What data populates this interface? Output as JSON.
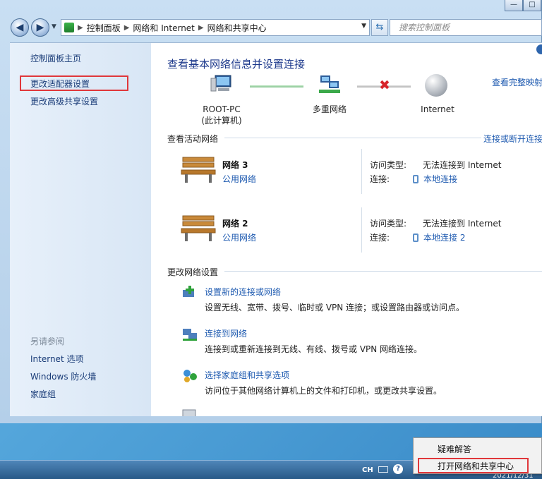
{
  "window": {
    "controls": [
      "—",
      "□"
    ]
  },
  "address": {
    "segments": [
      "控制面板",
      "网络和 Internet",
      "网络和共享中心"
    ],
    "search_placeholder": "搜索控制面板"
  },
  "sidebar": {
    "links": [
      "控制面板主页",
      "更改适配器设置",
      "更改高级共享设置"
    ],
    "see_also_title": "另请参阅",
    "see_also": [
      "Internet 选项",
      "Windows 防火墙",
      "家庭组"
    ]
  },
  "main": {
    "heading": "查看基本网络信息并设置连接",
    "full_map": "查看完整映射",
    "map": {
      "pc_name": "ROOT-PC",
      "pc_sub": "(此计算机)",
      "middle": "多重网络",
      "internet": "Internet"
    },
    "active_title": "查看活动网络",
    "connect_disconnect": "连接或断开连接",
    "networks": [
      {
        "name": "网络  3",
        "type": "公用网络",
        "access_label": "访问类型:",
        "access_value": "无法连接到 Internet",
        "conn_label": "连接:",
        "conn_value": "本地连接"
      },
      {
        "name": "网络  2",
        "type": "公用网络",
        "access_label": "访问类型:",
        "access_value": "无法连接到 Internet",
        "conn_label": "连接:",
        "conn_value": "本地连接 2"
      }
    ],
    "change_title": "更改网络设置",
    "tasks": [
      {
        "link": "设置新的连接或网络",
        "desc": "设置无线、宽带、拨号、临时或 VPN 连接；或设置路由器或访问点。"
      },
      {
        "link": "连接到网络",
        "desc": "连接到或重新连接到无线、有线、拨号或 VPN 网络连接。"
      },
      {
        "link": "选择家庭组和共享选项",
        "desc": "访问位于其他网络计算机上的文件和打印机，或更改共享设置。"
      }
    ]
  },
  "taskbar": {
    "lang": "CH",
    "help": "?",
    "date": "2021/12/31"
  },
  "context_menu": {
    "items": [
      "疑难解答",
      "打开网络和共享中心"
    ]
  }
}
